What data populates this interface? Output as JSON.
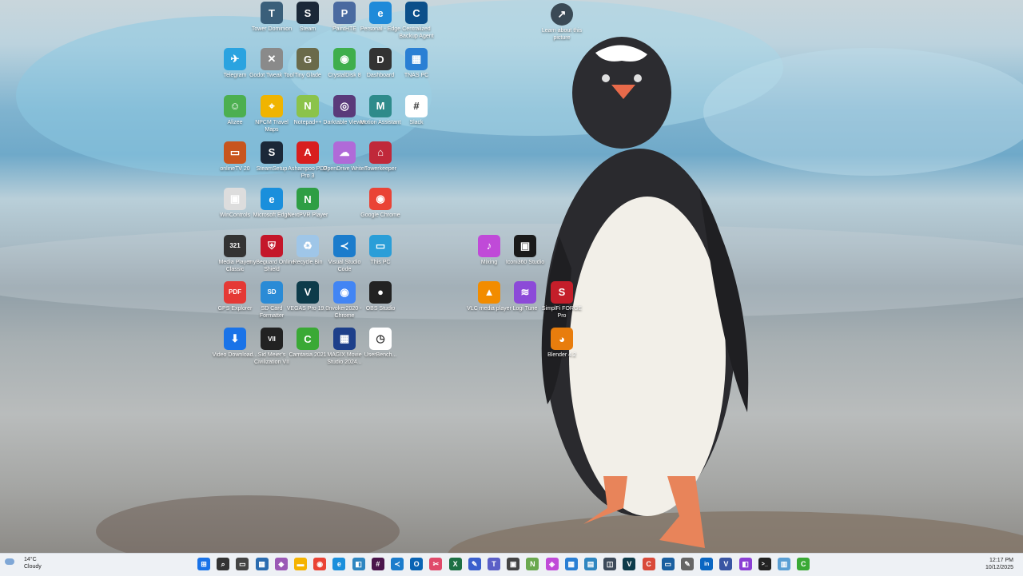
{
  "desktop": {
    "learn": {
      "label": "Learn about this picture",
      "icon": "info-icon"
    },
    "icons": [
      {
        "label": "Tower Dominion",
        "color": "#3a5f7a",
        "glyph": "T",
        "col": 0,
        "row": 0
      },
      {
        "label": "Steam",
        "color": "#1b2838",
        "glyph": "S",
        "col": 1,
        "row": 0
      },
      {
        "label": "PaintHTE",
        "color": "#4a6aa0",
        "glyph": "P",
        "col": 2,
        "row": 0
      },
      {
        "label": "Personal - Edge",
        "color": "#1f8ad9",
        "glyph": "e",
        "col": 3,
        "row": 0
      },
      {
        "label": "Centralized Backup Agent",
        "color": "#0b4f8a",
        "glyph": "C",
        "col": 4,
        "row": 0
      },
      {
        "label": "Telegram",
        "color": "#2aa3e0",
        "glyph": "✈",
        "col": -1,
        "row": 1
      },
      {
        "label": "Godot Tweak Tool",
        "color": "#8a8a8a",
        "glyph": "✕",
        "col": 0,
        "row": 1
      },
      {
        "label": "Tiny Glade",
        "color": "#6a6a4a",
        "glyph": "G",
        "col": 1,
        "row": 1
      },
      {
        "label": "CrystalDisk 8",
        "color": "#3fae4c",
        "glyph": "◉",
        "col": 2,
        "row": 1
      },
      {
        "label": "Dashboard",
        "color": "#333333",
        "glyph": "D",
        "col": 3,
        "row": 1
      },
      {
        "label": "TNAS PC",
        "color": "#2a7fd4",
        "glyph": "▦",
        "col": 4,
        "row": 1
      },
      {
        "label": "Alizee",
        "color": "#4caf50",
        "glyph": "☺",
        "col": -1,
        "row": 2
      },
      {
        "label": "NPCM Travel Maps",
        "color": "#f0b400",
        "glyph": "⌖",
        "col": 0,
        "row": 2
      },
      {
        "label": "Notepad++",
        "color": "#8bc34a",
        "glyph": "N",
        "col": 1,
        "row": 2
      },
      {
        "label": "Darktable Viewer",
        "color": "#5a3a7a",
        "glyph": "◎",
        "col": 2,
        "row": 2
      },
      {
        "label": "Motion Assistant",
        "color": "#2e8b8b",
        "glyph": "M",
        "col": 3,
        "row": 2
      },
      {
        "label": "Slack",
        "color": "#ffffff",
        "glyph": "#",
        "col": 4,
        "row": 2
      },
      {
        "label": "onlineTV 20",
        "color": "#c8551e",
        "glyph": "▭",
        "col": -1,
        "row": 3
      },
      {
        "label": "SteamSetup",
        "color": "#1b2838",
        "glyph": "S",
        "col": 0,
        "row": 3
      },
      {
        "label": "Ashampoo PDF Pro 3",
        "color": "#d81e1e",
        "glyph": "A",
        "col": 1,
        "row": 3
      },
      {
        "label": "OpenDrive Writer",
        "color": "#b06ad8",
        "glyph": "☁",
        "col": 2,
        "row": 3
      },
      {
        "label": "Towerkeeper",
        "color": "#c0283a",
        "glyph": "⌂",
        "col": 3,
        "row": 3
      },
      {
        "label": "WinControls",
        "color": "#dddddd",
        "glyph": "▣",
        "col": -1,
        "row": 4
      },
      {
        "label": "Microsoft Edge",
        "color": "#1a8fdc",
        "glyph": "e",
        "col": 0,
        "row": 4
      },
      {
        "label": "NextPVR Player",
        "color": "#2e9e44",
        "glyph": "N",
        "col": 1,
        "row": 4
      },
      {
        "label": "Google Chrome",
        "color": "#ea4335",
        "glyph": "◉",
        "col": 3,
        "row": 4
      },
      {
        "label": "Media Player Classic",
        "color": "#333333",
        "glyph": "321",
        "col": -1,
        "row": 5
      },
      {
        "label": "myBeguard Online Shield",
        "color": "#c4162a",
        "glyph": "⛨",
        "col": 0,
        "row": 5
      },
      {
        "label": "Recycle Bin",
        "color": "#9fc6e8",
        "glyph": "♻",
        "col": 1,
        "row": 5
      },
      {
        "label": "Visual Studio Code",
        "color": "#1b7ccc",
        "glyph": "≺",
        "col": 2,
        "row": 5
      },
      {
        "label": "This PC",
        "color": "#2a9ed8",
        "glyph": "▭",
        "col": 3,
        "row": 5
      },
      {
        "label": "GPS Explorer",
        "color": "#e53935",
        "glyph": "PDF",
        "col": -1,
        "row": 6
      },
      {
        "label": "SD Card Formatter",
        "color": "#2a8bd6",
        "glyph": "SD",
        "col": 0,
        "row": 6
      },
      {
        "label": "VEGAS Pro 19.0",
        "color": "#0d3b4a",
        "glyph": "V",
        "col": 1,
        "row": 6
      },
      {
        "label": "Invoker2020 - Chrome",
        "color": "#4285f4",
        "glyph": "◉",
        "col": 2,
        "row": 6
      },
      {
        "label": "OBS Studio",
        "color": "#222222",
        "glyph": "●",
        "col": 3,
        "row": 6
      },
      {
        "label": "Video Download...",
        "color": "#1a73e8",
        "glyph": "⬇",
        "col": -1,
        "row": 7
      },
      {
        "label": "Sid Meier's Civilization VII",
        "color": "#222222",
        "glyph": "VII",
        "col": 0,
        "row": 7
      },
      {
        "label": "Camtasia 2021",
        "color": "#3aa935",
        "glyph": "C",
        "col": 1,
        "row": 7
      },
      {
        "label": "MAGIX Movie Studio 2024...",
        "color": "#1d3f8a",
        "glyph": "▦",
        "col": 2,
        "row": 7
      },
      {
        "label": "UserBench...",
        "color": "#ffffff",
        "glyph": "◷",
        "col": 3,
        "row": 7
      },
      {
        "label": "Mixing",
        "color": "#c04ad8",
        "glyph": "♪",
        "col": 6,
        "row": 5
      },
      {
        "label": "Iconi360 Studio",
        "color": "#1a1a1a",
        "glyph": "▣",
        "col": 7,
        "row": 5
      },
      {
        "label": "VLC media player",
        "color": "#f28c00",
        "glyph": "▲",
        "col": 6,
        "row": 6
      },
      {
        "label": "Logi Tune",
        "color": "#8c4ad8",
        "glyph": "≋",
        "col": 7,
        "row": 6
      },
      {
        "label": "SimplFi FORGE Pro",
        "color": "#c41e2a",
        "glyph": "S",
        "col": 8,
        "row": 6
      },
      {
        "label": "Blender 4.2",
        "color": "#e87d0d",
        "glyph": "◕",
        "col": 8,
        "row": 7
      }
    ]
  },
  "taskbar": {
    "weather": {
      "temp": "14°C",
      "condition": "Cloudy",
      "icon": "cloud-icon"
    },
    "clock": {
      "time": "12:17 PM",
      "date": "10/12/2025"
    },
    "apps": [
      {
        "name": "start-button",
        "color": "#1a73e8",
        "glyph": "⊞"
      },
      {
        "name": "search-button",
        "color": "#333333",
        "glyph": "⌕"
      },
      {
        "name": "task-view-button",
        "color": "#444444",
        "glyph": "▭"
      },
      {
        "name": "widgets-button",
        "color": "#2b6cb0",
        "glyph": "▦"
      },
      {
        "name": "copilot-button",
        "color": "#9b59b6",
        "glyph": "◆"
      },
      {
        "name": "file-explorer-button",
        "color": "#f5b301",
        "glyph": "▬"
      },
      {
        "name": "chrome-button",
        "color": "#ea4335",
        "glyph": "◉"
      },
      {
        "name": "edge-button",
        "color": "#1a8fdc",
        "glyph": "e"
      },
      {
        "name": "app-button-1",
        "color": "#2e86c1",
        "glyph": "◧"
      },
      {
        "name": "slack-button",
        "color": "#4a154b",
        "glyph": "#"
      },
      {
        "name": "vscode-button",
        "color": "#1b7ccc",
        "glyph": "≺"
      },
      {
        "name": "outlook-button",
        "color": "#0a64b4",
        "glyph": "O"
      },
      {
        "name": "snipping-tool-button",
        "color": "#e04a6a",
        "glyph": "✂"
      },
      {
        "name": "excel-button",
        "color": "#1d7044",
        "glyph": "X"
      },
      {
        "name": "app-button-2",
        "color": "#3a5fcd",
        "glyph": "✎"
      },
      {
        "name": "teams-button",
        "color": "#5b5fc7",
        "glyph": "T"
      },
      {
        "name": "app-button-3",
        "color": "#444444",
        "glyph": "▣"
      },
      {
        "name": "notepad-plus-button",
        "color": "#6aa84f",
        "glyph": "N"
      },
      {
        "name": "app-button-4",
        "color": "#c04ad8",
        "glyph": "◈"
      },
      {
        "name": "app-button-5",
        "color": "#2a7fd4",
        "glyph": "▦"
      },
      {
        "name": "app-button-6",
        "color": "#2e86c1",
        "glyph": "▤"
      },
      {
        "name": "app-button-7",
        "color": "#3c4a5a",
        "glyph": "◫"
      },
      {
        "name": "vegas-button",
        "color": "#0d3b4a",
        "glyph": "V"
      },
      {
        "name": "camtasia-red-button",
        "color": "#d94a3a",
        "glyph": "C"
      },
      {
        "name": "app-button-8",
        "color": "#1a5fa0",
        "glyph": "▭"
      },
      {
        "name": "app-button-9",
        "color": "#666666",
        "glyph": "✎"
      },
      {
        "name": "linkedin-button",
        "color": "#0a66c2",
        "glyph": "in"
      },
      {
        "name": "visio-button",
        "color": "#3955a3",
        "glyph": "V"
      },
      {
        "name": "app-button-10",
        "color": "#8b3fd4",
        "glyph": "◧"
      },
      {
        "name": "terminal-button",
        "color": "#222222",
        "glyph": ">_"
      },
      {
        "name": "app-button-11",
        "color": "#5a9fd4",
        "glyph": "▥"
      },
      {
        "name": "camtasia-button",
        "color": "#3aa935",
        "glyph": "C"
      }
    ]
  }
}
